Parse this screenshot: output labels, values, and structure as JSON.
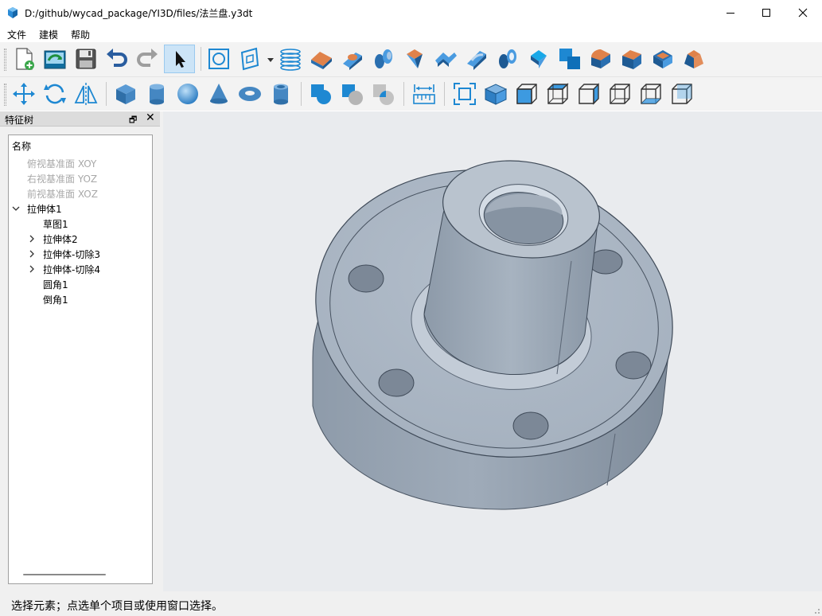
{
  "window": {
    "title": "D:/github/wycad_package/YI3D/files/法兰盘.y3dt",
    "icons": {
      "app": "app-cube-icon",
      "minimize": "minimize-icon",
      "maximize": "maximize-icon",
      "close": "close-icon"
    }
  },
  "menu": {
    "items": [
      "文件",
      "建模",
      "帮助"
    ]
  },
  "toolbar1": {
    "buttons": [
      "new-file",
      "open-file",
      "save-file",
      "undo",
      "redo",
      "select",
      "sketch",
      "plane",
      "helix",
      "extrude",
      "extrude-cut",
      "revolve",
      "sweep",
      "loft",
      "loft-cut",
      "revolve-cut",
      "sweep-cut",
      "loft-solid",
      "boolean-union",
      "fillet",
      "chamfer",
      "shell",
      "draft"
    ],
    "active": "select"
  },
  "toolbar2": {
    "buttons": [
      "move",
      "rotate",
      "mirror",
      "box",
      "cylinder",
      "sphere",
      "cone",
      "torus",
      "tube",
      "boolean-union",
      "boolean-cut",
      "boolean-intersect",
      "measure",
      "fit-all",
      "view-iso",
      "view-front",
      "view-top",
      "view-right",
      "view-left",
      "view-bottom",
      "view-back"
    ]
  },
  "feature_tree": {
    "title": "特征树",
    "header": "名称",
    "items": [
      {
        "label": "俯视基准面 XOY",
        "depth": 1,
        "dim": true,
        "expander": "none"
      },
      {
        "label": "右视基准面 YOZ",
        "depth": 1,
        "dim": true,
        "expander": "none"
      },
      {
        "label": "前视基准面 XOZ",
        "depth": 1,
        "dim": true,
        "expander": "none"
      },
      {
        "label": "拉伸体1",
        "depth": 0,
        "dim": false,
        "expander": "expanded"
      },
      {
        "label": "草图1",
        "depth": 2,
        "dim": false,
        "expander": "none"
      },
      {
        "label": "拉伸体2",
        "depth": 2,
        "dim": false,
        "expander": "collapsed"
      },
      {
        "label": "拉伸体-切除3",
        "depth": 2,
        "dim": false,
        "expander": "collapsed"
      },
      {
        "label": "拉伸体-切除4",
        "depth": 2,
        "dim": false,
        "expander": "collapsed"
      },
      {
        "label": "圆角1",
        "depth": 2,
        "dim": false,
        "expander": "none"
      },
      {
        "label": "倒角1",
        "depth": 2,
        "dim": false,
        "expander": "none"
      }
    ]
  },
  "viewport": {
    "model": "flange-disc-3d-model",
    "background": "#e9ebee",
    "model_color": "#a3afbd"
  },
  "status": {
    "text": "选择元素；点选单个项目或使用窗口选择。"
  },
  "colors": {
    "accent_blue": "#1e88d2",
    "orange": "#e0824a",
    "dock_title_bg": "#dcdcdc"
  }
}
